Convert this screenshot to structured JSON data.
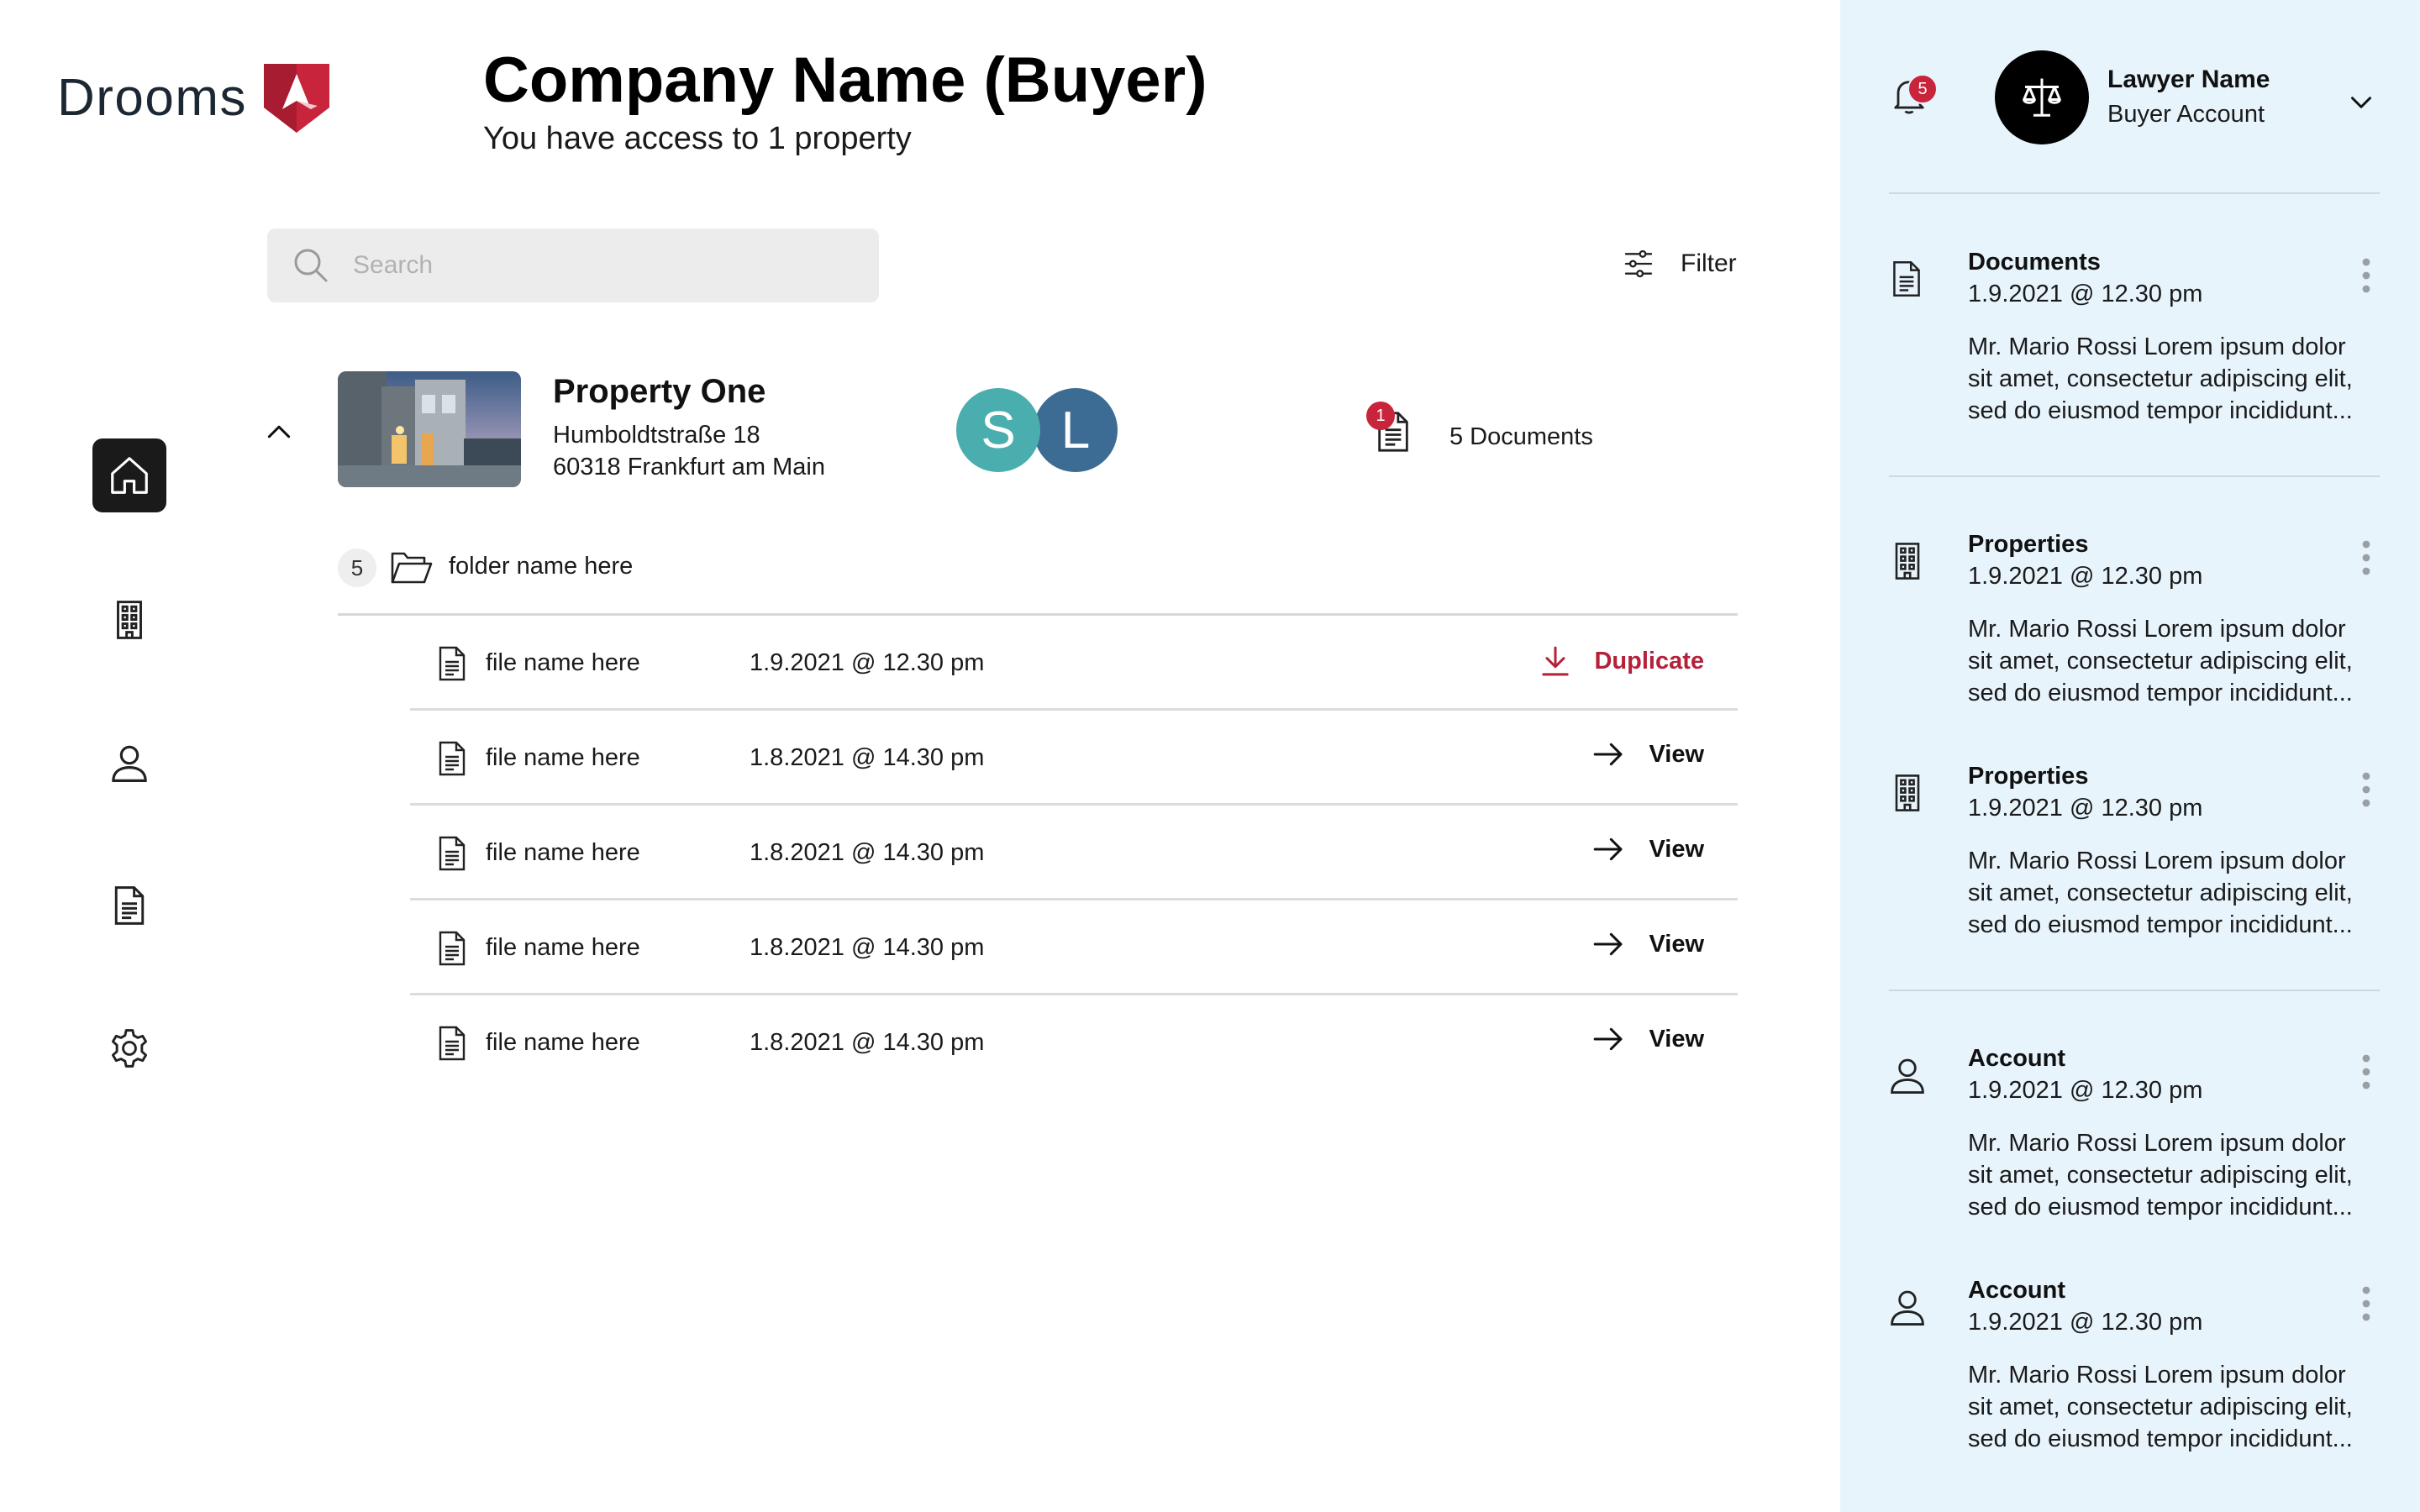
{
  "brand": {
    "name": "Drooms",
    "accent": "#c8243c"
  },
  "header": {
    "title": "Company Name (Buyer)",
    "subtitle": "You have access to 1 property"
  },
  "nav": [
    {
      "icon": "home-icon",
      "active": true
    },
    {
      "icon": "building-icon",
      "active": false
    },
    {
      "icon": "user-icon",
      "active": false
    },
    {
      "icon": "document-icon",
      "active": false
    },
    {
      "icon": "gear-icon",
      "active": false
    }
  ],
  "search": {
    "placeholder": "Search"
  },
  "filter": {
    "label": "Filter"
  },
  "property": {
    "name": "Property One",
    "address_line1": "Humboldtstraße 18",
    "address_line2": "60318 Frankfurt am Main",
    "members": [
      {
        "initial": "S",
        "color": "#4aaeae"
      },
      {
        "initial": "L",
        "color": "#3c6b94"
      }
    ],
    "documents_badge": "1",
    "documents_label": "5 Documents"
  },
  "folder": {
    "count": "5",
    "name": "folder name here"
  },
  "files": [
    {
      "name": "file name here",
      "date": "1.9.2021 @ 12.30 pm",
      "action": "Duplicate",
      "action_icon": "download-icon",
      "action_color": "#b3213a"
    },
    {
      "name": "file name here",
      "date": "1.8.2021 @ 14.30 pm",
      "action": "View",
      "action_icon": "arrow-right-icon",
      "action_color": "#111111"
    },
    {
      "name": "file name here",
      "date": "1.8.2021 @ 14.30 pm",
      "action": "View",
      "action_icon": "arrow-right-icon",
      "action_color": "#111111"
    },
    {
      "name": "file name here",
      "date": "1.8.2021 @ 14.30 pm",
      "action": "View",
      "action_icon": "arrow-right-icon",
      "action_color": "#111111"
    },
    {
      "name": "file name here",
      "date": "1.8.2021 @ 14.30 pm",
      "action": "View",
      "action_icon": "arrow-right-icon",
      "action_color": "#111111"
    }
  ],
  "user": {
    "notification_count": "5",
    "name": "Lawyer Name",
    "role": "Buyer Account"
  },
  "notifications": [
    {
      "icon": "document-icon",
      "title": "Documents",
      "date": "1.9.2021 @ 12.30 pm",
      "body": "Mr. Mario Rossi Lorem ipsum dolor sit amet, consectetur adipiscing elit, sed do eiusmod tempor incididunt..."
    },
    {
      "icon": "building-icon",
      "title": "Properties",
      "date": "1.9.2021 @ 12.30 pm",
      "body": "Mr. Mario Rossi Lorem ipsum dolor sit amet, consectetur adipiscing elit, sed do eiusmod tempor incididunt..."
    },
    {
      "icon": "building-icon",
      "title": "Properties",
      "date": "1.9.2021 @ 12.30 pm",
      "body": "Mr. Mario Rossi Lorem ipsum dolor sit amet, consectetur adipiscing elit, sed do eiusmod tempor incididunt..."
    },
    {
      "icon": "user-icon",
      "title": "Account",
      "date": "1.9.2021 @ 12.30 pm",
      "body": "Mr. Mario Rossi Lorem ipsum dolor sit amet, consectetur adipiscing elit, sed do eiusmod tempor incididunt..."
    },
    {
      "icon": "user-icon",
      "title": "Account",
      "date": "1.9.2021 @ 12.30 pm",
      "body": "Mr. Mario Rossi Lorem ipsum dolor sit amet, consectetur adipiscing elit, sed do eiusmod tempor incididunt..."
    }
  ]
}
